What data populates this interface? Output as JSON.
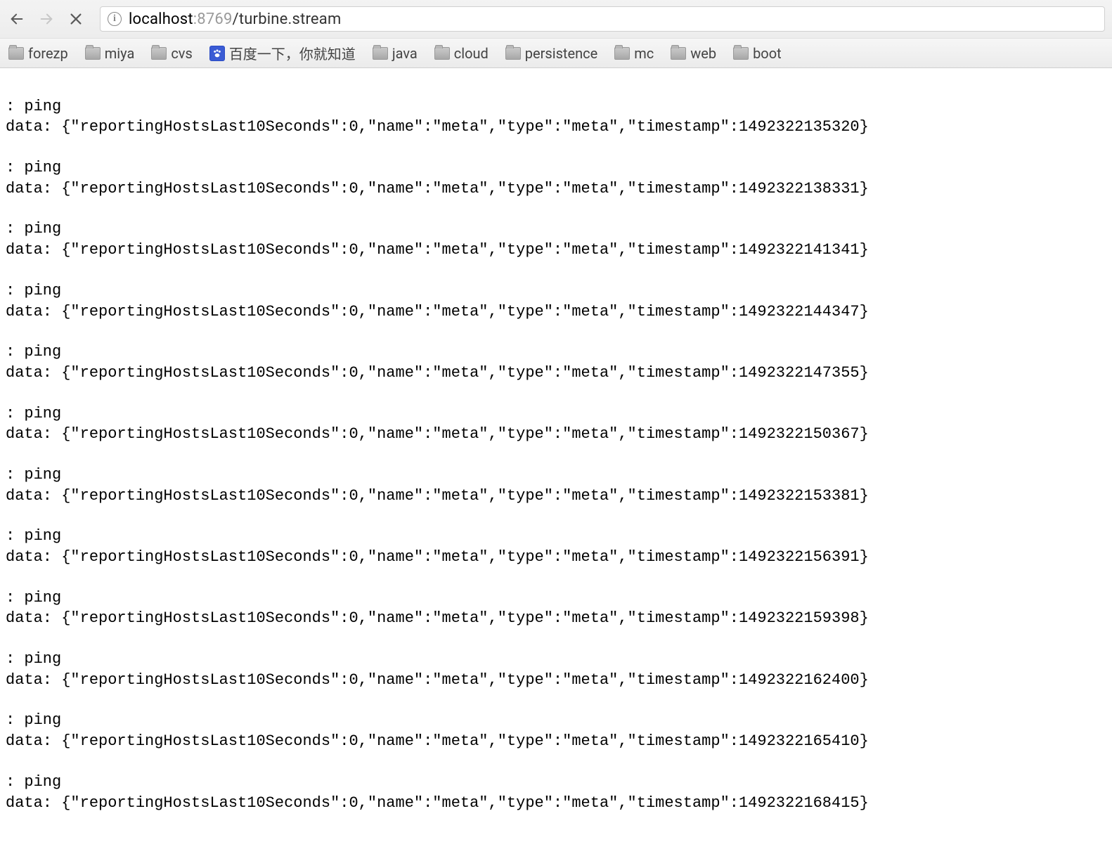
{
  "nav": {
    "back_enabled": true,
    "forward_enabled": false,
    "stop_enabled": true
  },
  "address": {
    "host": "localhost",
    "port": ":8769",
    "path": "/turbine.stream"
  },
  "bookmarks": [
    {
      "label": "forezp",
      "icon": "folder"
    },
    {
      "label": "miya",
      "icon": "folder"
    },
    {
      "label": "cvs",
      "icon": "folder"
    },
    {
      "label": "百度一下，你就知道",
      "icon": "baidu"
    },
    {
      "label": "java",
      "icon": "folder"
    },
    {
      "label": "cloud",
      "icon": "folder"
    },
    {
      "label": "persistence",
      "icon": "folder"
    },
    {
      "label": "mc",
      "icon": "folder"
    },
    {
      "label": "web",
      "icon": "folder"
    },
    {
      "label": "boot",
      "icon": "folder"
    }
  ],
  "stream": [
    {
      "ping": ": ping",
      "data": "data: {\"reportingHostsLast10Seconds\":0,\"name\":\"meta\",\"type\":\"meta\",\"timestamp\":1492322135320}"
    },
    {
      "ping": ": ping",
      "data": "data: {\"reportingHostsLast10Seconds\":0,\"name\":\"meta\",\"type\":\"meta\",\"timestamp\":1492322138331}"
    },
    {
      "ping": ": ping",
      "data": "data: {\"reportingHostsLast10Seconds\":0,\"name\":\"meta\",\"type\":\"meta\",\"timestamp\":1492322141341}"
    },
    {
      "ping": ": ping",
      "data": "data: {\"reportingHostsLast10Seconds\":0,\"name\":\"meta\",\"type\":\"meta\",\"timestamp\":1492322144347}"
    },
    {
      "ping": ": ping",
      "data": "data: {\"reportingHostsLast10Seconds\":0,\"name\":\"meta\",\"type\":\"meta\",\"timestamp\":1492322147355}"
    },
    {
      "ping": ": ping",
      "data": "data: {\"reportingHostsLast10Seconds\":0,\"name\":\"meta\",\"type\":\"meta\",\"timestamp\":1492322150367}"
    },
    {
      "ping": ": ping",
      "data": "data: {\"reportingHostsLast10Seconds\":0,\"name\":\"meta\",\"type\":\"meta\",\"timestamp\":1492322153381}"
    },
    {
      "ping": ": ping",
      "data": "data: {\"reportingHostsLast10Seconds\":0,\"name\":\"meta\",\"type\":\"meta\",\"timestamp\":1492322156391}"
    },
    {
      "ping": ": ping",
      "data": "data: {\"reportingHostsLast10Seconds\":0,\"name\":\"meta\",\"type\":\"meta\",\"timestamp\":1492322159398}"
    },
    {
      "ping": ": ping",
      "data": "data: {\"reportingHostsLast10Seconds\":0,\"name\":\"meta\",\"type\":\"meta\",\"timestamp\":1492322162400}"
    },
    {
      "ping": ": ping",
      "data": "data: {\"reportingHostsLast10Seconds\":0,\"name\":\"meta\",\"type\":\"meta\",\"timestamp\":1492322165410}"
    },
    {
      "ping": ": ping",
      "data": "data: {\"reportingHostsLast10Seconds\":0,\"name\":\"meta\",\"type\":\"meta\",\"timestamp\":1492322168415}"
    }
  ]
}
